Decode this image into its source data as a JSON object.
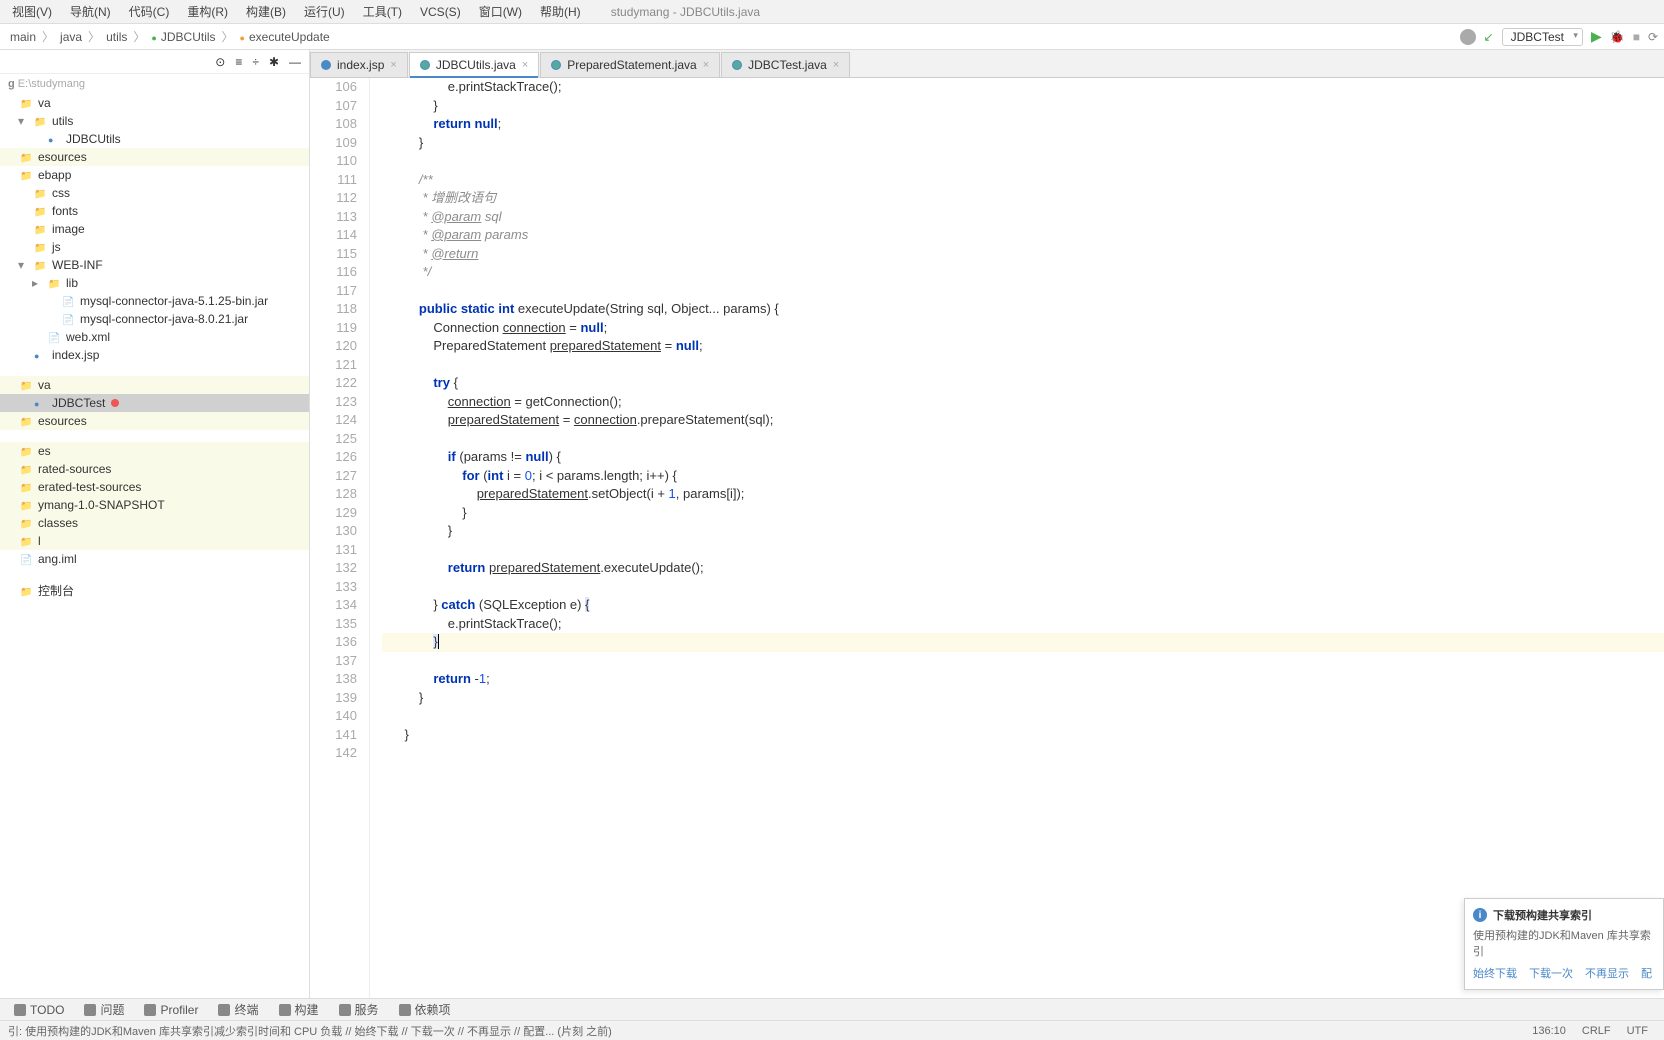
{
  "window_title": "studymang - JDBCUtils.java",
  "menu": [
    "视图(V)",
    "导航(N)",
    "代码(C)",
    "重构(R)",
    "构建(B)",
    "运行(U)",
    "工具(T)",
    "VCS(S)",
    "窗口(W)",
    "帮助(H)"
  ],
  "breadcrumbs": {
    "items": [
      "main",
      "java",
      "utils",
      "JDBCUtils",
      "executeUpdate"
    ]
  },
  "run_config": "JDBCTest",
  "sidebar": {
    "project_label": "g",
    "project_path": "E:\\studymang",
    "items": [
      {
        "label": "va",
        "indent": 0,
        "type": "folder"
      },
      {
        "label": "utils",
        "indent": 1,
        "type": "folder",
        "arrow": "▾"
      },
      {
        "label": "JDBCUtils",
        "indent": 2,
        "type": "class"
      },
      {
        "label": "esources",
        "indent": 0,
        "type": "folder",
        "highlighted": true
      },
      {
        "label": "ebapp",
        "indent": 0,
        "type": "folder"
      },
      {
        "label": "css",
        "indent": 1,
        "type": "folder"
      },
      {
        "label": "fonts",
        "indent": 1,
        "type": "folder"
      },
      {
        "label": "image",
        "indent": 1,
        "type": "folder"
      },
      {
        "label": "js",
        "indent": 1,
        "type": "folder"
      },
      {
        "label": "WEB-INF",
        "indent": 1,
        "type": "folder",
        "arrow": "▾"
      },
      {
        "label": "lib",
        "indent": 2,
        "type": "folder",
        "arrow": "▸"
      },
      {
        "label": "mysql-connector-java-5.1.25-bin.jar",
        "indent": 3,
        "type": "jar"
      },
      {
        "label": "mysql-connector-java-8.0.21.jar",
        "indent": 3,
        "type": "jar"
      },
      {
        "label": "web.xml",
        "indent": 2,
        "type": "file"
      },
      {
        "label": "index.jsp",
        "indent": 1,
        "type": "jsp"
      },
      {
        "label": "",
        "indent": 0,
        "type": "spacer"
      },
      {
        "label": "va",
        "indent": 0,
        "type": "folder",
        "highlighted": true
      },
      {
        "label": "JDBCTest",
        "indent": 1,
        "type": "class",
        "selected": true,
        "error": true
      },
      {
        "label": "esources",
        "indent": 0,
        "type": "folder",
        "highlighted": true
      },
      {
        "label": "",
        "indent": 0,
        "type": "spacer"
      },
      {
        "label": "es",
        "indent": 0,
        "type": "folder",
        "highlighted": true
      },
      {
        "label": "rated-sources",
        "indent": 0,
        "type": "folder",
        "highlighted": true
      },
      {
        "label": "erated-test-sources",
        "indent": 0,
        "type": "folder",
        "highlighted": true
      },
      {
        "label": "ymang-1.0-SNAPSHOT",
        "indent": 0,
        "type": "folder",
        "highlighted": true
      },
      {
        "label": "classes",
        "indent": 0,
        "type": "folder",
        "highlighted": true
      },
      {
        "label": "l",
        "indent": 0,
        "type": "folder",
        "highlighted": true
      },
      {
        "label": "ang.iml",
        "indent": 0,
        "type": "file"
      },
      {
        "label": "",
        "indent": 0,
        "type": "spacer"
      },
      {
        "label": "控制台",
        "indent": 0,
        "type": "text"
      }
    ]
  },
  "tabs": [
    {
      "label": "index.jsp",
      "icon": "jsp",
      "active": false
    },
    {
      "label": "JDBCUtils.java",
      "icon": "java",
      "active": true
    },
    {
      "label": "PreparedStatement.java",
      "icon": "java",
      "active": false
    },
    {
      "label": "JDBCTest.java",
      "icon": "java",
      "active": false
    }
  ],
  "code_start_line": 106,
  "code_lines": [
    "                e.printStackTrace();",
    "            }",
    "            return null;",
    "        }",
    "",
    "        /**",
    "         * 增删改语句",
    "         * @param sql",
    "         * @param params",
    "         * @return",
    "         */",
    "",
    "        public static int executeUpdate(String sql, Object... params) {",
    "            Connection connection = null;",
    "            PreparedStatement preparedStatement = null;",
    "",
    "            try {",
    "                connection = getConnection();",
    "                preparedStatement = connection.prepareStatement(sql);",
    "",
    "                if (params != null) {",
    "                    for (int i = 0; i < params.length; i++) {",
    "                        preparedStatement.setObject(i + 1, params[i]);",
    "                    }",
    "                }",
    "",
    "                return preparedStatement.executeUpdate();",
    "",
    "            } catch (SQLException e) {",
    "                e.printStackTrace();",
    "            }",
    "",
    "            return -1;",
    "        }",
    "",
    "    }",
    ""
  ],
  "current_line_index": 30,
  "notification": {
    "title": "下载预构建共享索引",
    "body": "使用预构建的JDK和Maven 库共享索引",
    "actions": [
      "始终下载",
      "下载一次",
      "不再显示",
      "配"
    ]
  },
  "bottom_tools": [
    "TODO",
    "问题",
    "Profiler",
    "终端",
    "构建",
    "服务",
    "依赖项"
  ],
  "status": {
    "msg": "引: 使用预构建的JDK和Maven 库共享索引减少索引时间和 CPU 负载 // 始终下载 // 下载一次 // 不再显示 // 配置... (片刻 之前)",
    "pos": "136:10",
    "eol": "CRLF",
    "enc": "UTF"
  }
}
